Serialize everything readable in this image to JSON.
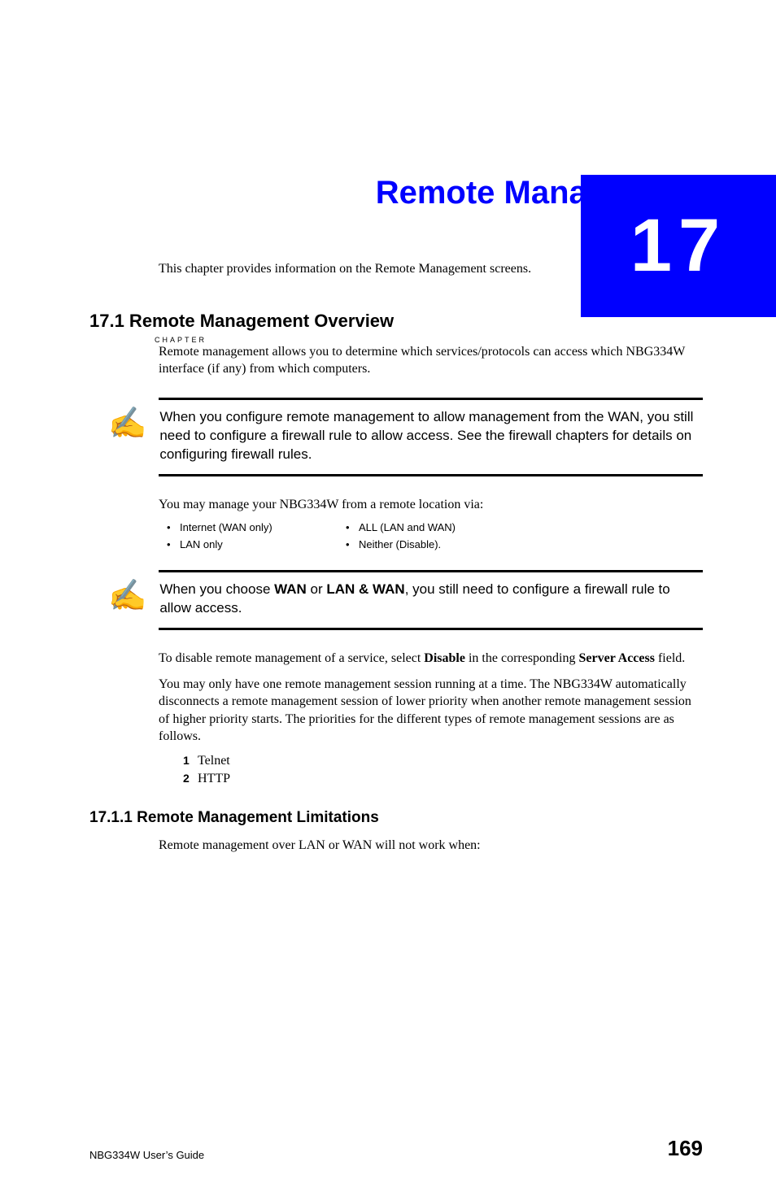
{
  "chapter": {
    "number": "17",
    "prefix": "CHAPTER",
    "title": "Remote Management"
  },
  "intro": "This chapter provides information on the Remote Management screens.",
  "section1": {
    "heading": "17.1  Remote Management Overview",
    "p1": "Remote management allows you to determine which services/protocols can access which NBG334W interface (if any) from which computers.",
    "note1": "When you configure remote management to allow management from the WAN, you still need to configure a firewall rule to allow access. See the firewall chapters for details on configuring firewall rules.",
    "p2": "You may manage your NBG334W from a remote location via:",
    "cols": {
      "r1c1": "Internet (WAN only)",
      "r1c2": "ALL (LAN and WAN)",
      "r2c1": "LAN only",
      "r2c2": "Neither (Disable)."
    },
    "note2_pre": "When you choose ",
    "note2_b1": "WAN",
    "note2_mid": " or ",
    "note2_b2": "LAN & WAN",
    "note2_post": ", you still need to configure a firewall rule to allow access.",
    "p3_pre": "To disable remote management of a service, select ",
    "p3_b1": "Disable",
    "p3_mid": " in the corresponding ",
    "p3_b2": "Server Access",
    "p3_post": " field.",
    "p4": "You may only have one remote management session running at a time. The NBG334W automatically disconnects a remote management session of lower priority when another remote management session of higher priority starts. The priorities for the different types of remote management sessions are as follows.",
    "list": {
      "n1": "1",
      "i1": "Telnet",
      "n2": "2",
      "i2": "HTTP"
    }
  },
  "section2": {
    "heading": "17.1.1  Remote Management Limitations",
    "p1": "Remote management over LAN or WAN will not work when:"
  },
  "footer": {
    "left": "NBG334W User’s Guide",
    "right": "169"
  },
  "icons": {
    "note": "✍"
  }
}
